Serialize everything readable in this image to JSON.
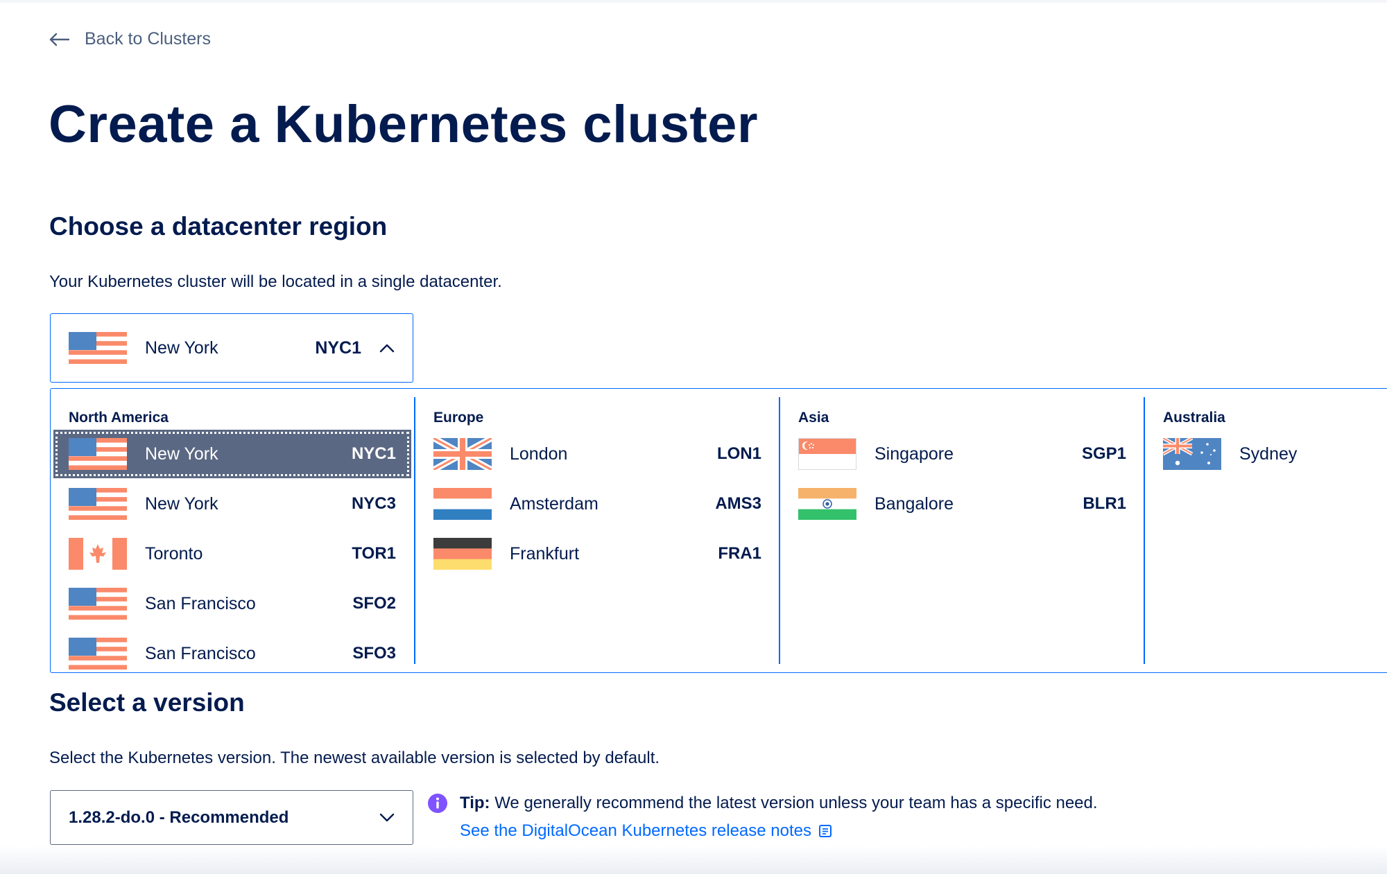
{
  "nav": {
    "back_label": "Back to Clusters"
  },
  "page": {
    "title": "Create a Kubernetes cluster"
  },
  "region": {
    "heading": "Choose a datacenter region",
    "description": "Your Kubernetes cluster will be located in a single datacenter.",
    "selected": {
      "city": "New York",
      "code": "NYC1",
      "flag": "us-flag-icon"
    },
    "groups": [
      {
        "name": "North America",
        "items": [
          {
            "city": "New York",
            "code": "NYC1",
            "flag": "us-flag-icon",
            "selected": true
          },
          {
            "city": "New York",
            "code": "NYC3",
            "flag": "us-flag-icon"
          },
          {
            "city": "Toronto",
            "code": "TOR1",
            "flag": "canada-flag-icon"
          },
          {
            "city": "San Francisco",
            "code": "SFO2",
            "flag": "us-flag-icon"
          },
          {
            "city": "San Francisco",
            "code": "SFO3",
            "flag": "us-flag-icon"
          }
        ]
      },
      {
        "name": "Europe",
        "items": [
          {
            "city": "London",
            "code": "LON1",
            "flag": "uk-flag-icon"
          },
          {
            "city": "Amsterdam",
            "code": "AMS3",
            "flag": "netherlands-flag-icon"
          },
          {
            "city": "Frankfurt",
            "code": "FRA1",
            "flag": "germany-flag-icon"
          }
        ]
      },
      {
        "name": "Asia",
        "items": [
          {
            "city": "Singapore",
            "code": "SGP1",
            "flag": "singapore-flag-icon"
          },
          {
            "city": "Bangalore",
            "code": "BLR1",
            "flag": "india-flag-icon"
          }
        ]
      },
      {
        "name": "Australia",
        "items": [
          {
            "city": "Sydney",
            "code": "",
            "flag": "australia-flag-icon"
          }
        ]
      }
    ]
  },
  "version": {
    "heading": "Select a version",
    "description": "Select the Kubernetes version. The newest available version is selected by default.",
    "selected": "1.28.2-do.0 - Recommended",
    "tip_label": "Tip:",
    "tip_text": " We generally recommend the latest version unless your team has a specific need.",
    "tip_link": "See the DigitalOcean Kubernetes release notes"
  },
  "colors": {
    "accent": "#0069ff",
    "navy": "#031b4e",
    "selected_bg": "#5b6883",
    "tip_icon": "#7f53ff"
  }
}
